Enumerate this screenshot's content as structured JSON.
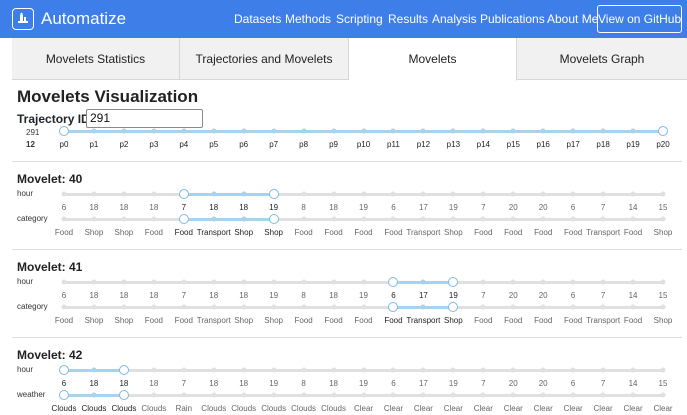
{
  "navbar": {
    "brand": "Automatize",
    "links": [
      "Datasets",
      "Methods",
      "Scripting",
      "Results",
      "Analysis",
      "Publications",
      "About Me"
    ],
    "github_button": "View on GitHub"
  },
  "tabs": [
    {
      "label": "Movelets Statistics",
      "active": false
    },
    {
      "label": "Trajectories and Movelets",
      "active": false
    },
    {
      "label": "Movelets",
      "active": true
    },
    {
      "label": "Movelets Graph",
      "active": false
    }
  ],
  "page_title": "Movelets Visualization",
  "trajectory": {
    "label": "Trajectory ID:",
    "value": "291",
    "id_text": "291",
    "count_text": "12",
    "points": [
      "p0",
      "p1",
      "p2",
      "p3",
      "p4",
      "p5",
      "p6",
      "p7",
      "p8",
      "p9",
      "p10",
      "p11",
      "p12",
      "p13",
      "p14",
      "p15",
      "p16",
      "p17",
      "p18",
      "p19",
      "p20"
    ]
  },
  "movelets": [
    {
      "title": "Movelet: 40",
      "range": [
        4,
        7
      ],
      "rows": [
        {
          "label": "hour",
          "values": [
            "6",
            "18",
            "18",
            "18",
            "7",
            "18",
            "18",
            "19",
            "8",
            "18",
            "19",
            "6",
            "17",
            "19",
            "7",
            "20",
            "20",
            "6",
            "7",
            "14",
            "15"
          ]
        },
        {
          "label": "category",
          "values": [
            "Food",
            "Shop",
            "Shop",
            "Food",
            "Food",
            "Transport",
            "Shop",
            "Shop",
            "Food",
            "Food",
            "Food",
            "Food",
            "Transport",
            "Shop",
            "Food",
            "Food",
            "Food",
            "Food",
            "Transport",
            "Food",
            "Shop"
          ]
        }
      ]
    },
    {
      "title": "Movelet: 41",
      "range": [
        11,
        13
      ],
      "rows": [
        {
          "label": "hour",
          "values": [
            "6",
            "18",
            "18",
            "18",
            "7",
            "18",
            "18",
            "19",
            "8",
            "18",
            "19",
            "6",
            "17",
            "19",
            "7",
            "20",
            "20",
            "6",
            "7",
            "14",
            "15"
          ]
        },
        {
          "label": "category",
          "values": [
            "Food",
            "Shop",
            "Shop",
            "Food",
            "Food",
            "Transport",
            "Shop",
            "Shop",
            "Food",
            "Food",
            "Food",
            "Food",
            "Transport",
            "Shop",
            "Food",
            "Food",
            "Food",
            "Food",
            "Transport",
            "Food",
            "Shop"
          ]
        }
      ]
    },
    {
      "title": "Movelet: 42",
      "range": [
        0,
        2
      ],
      "rows": [
        {
          "label": "hour",
          "values": [
            "6",
            "18",
            "18",
            "18",
            "7",
            "18",
            "18",
            "19",
            "8",
            "18",
            "19",
            "6",
            "17",
            "19",
            "7",
            "20",
            "20",
            "6",
            "7",
            "14",
            "15"
          ]
        },
        {
          "label": "weather",
          "values": [
            "Clouds",
            "Clouds",
            "Clouds",
            "Clouds",
            "Rain",
            "Clouds",
            "Clouds",
            "Clouds",
            "Clouds",
            "Clouds",
            "Clear",
            "Clear",
            "Clear",
            "Clear",
            "Clear",
            "Clear",
            "Clear",
            "Clear",
            "Clear",
            "Clear",
            "Clear"
          ]
        }
      ]
    }
  ],
  "colors": {
    "navbar": "#3d7ee8",
    "accent": "#a9d3ec",
    "knob_border": "#7bbbe2"
  }
}
